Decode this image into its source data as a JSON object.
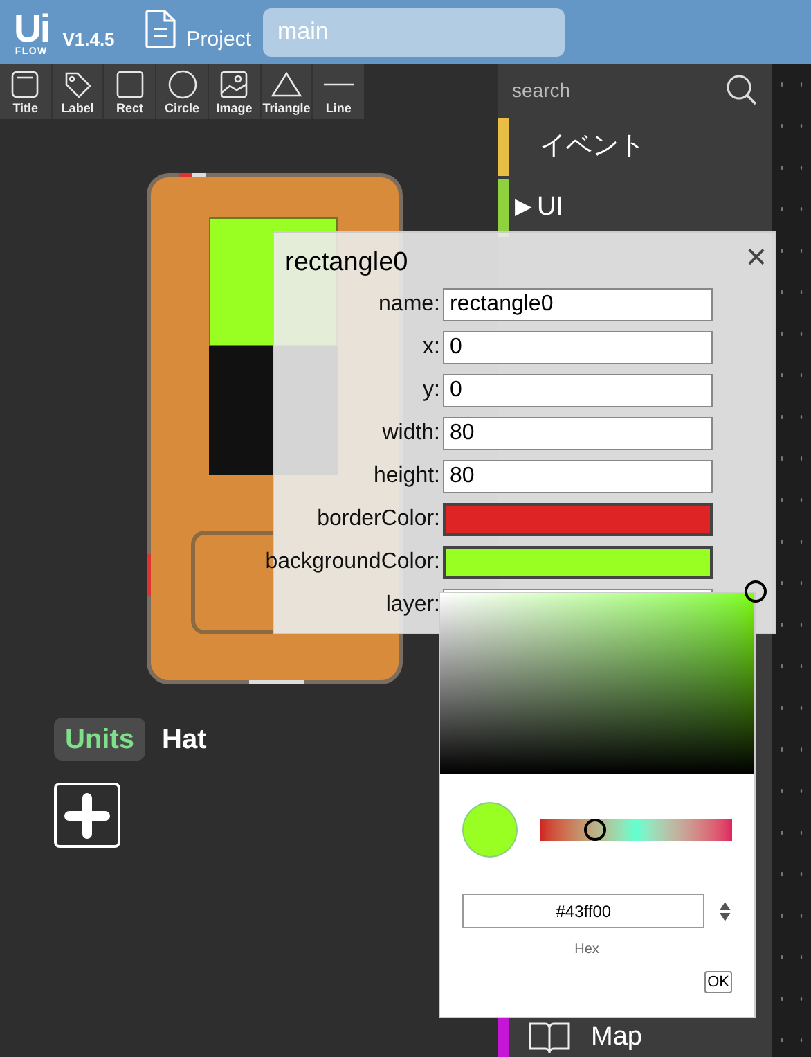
{
  "header": {
    "logo_top": "Ui",
    "logo_bottom": "FLOW",
    "version": "V1.4.5",
    "project_label": "Project",
    "file_name": "main"
  },
  "toolbar": [
    {
      "kind": "title",
      "label": "Title"
    },
    {
      "kind": "label",
      "label": "Label"
    },
    {
      "kind": "rect",
      "label": "Rect"
    },
    {
      "kind": "circle",
      "label": "Circle"
    },
    {
      "kind": "image",
      "label": "Image"
    },
    {
      "kind": "triangle",
      "label": "Triangle"
    },
    {
      "kind": "line",
      "label": "Line"
    }
  ],
  "unit_tabs": [
    {
      "label": "Units",
      "selected": true
    },
    {
      "label": "Hat",
      "selected": false
    }
  ],
  "sidebar": {
    "search_placeholder": "search",
    "categories": [
      {
        "label": "イベント",
        "color": "#e8be45"
      },
      {
        "label": "UI",
        "color": "#8fd13e",
        "arrow": "▶"
      }
    ],
    "bottom_item": {
      "label": "Map",
      "color": "#c516d6"
    }
  },
  "dialog": {
    "title": "rectangle0",
    "close": "×",
    "fields": [
      {
        "kind": "text",
        "label": "name:",
        "value": "rectangle0"
      },
      {
        "kind": "text",
        "label": "x:",
        "value": "0"
      },
      {
        "kind": "text",
        "label": "y:",
        "value": "0"
      },
      {
        "kind": "text",
        "label": "width:",
        "value": "80"
      },
      {
        "kind": "text",
        "label": "height:",
        "value": "80"
      },
      {
        "kind": "color",
        "label": "borderColor:",
        "color": "#de2424"
      },
      {
        "kind": "color",
        "label": "backgroundColor:",
        "color": "#99ff22"
      },
      {
        "kind": "select",
        "label": "layer:"
      }
    ]
  },
  "color_picker": {
    "hue": {
      "level": 0.29
    },
    "hex": "#43ff00",
    "hex_label": "Hex",
    "ok": "OK"
  }
}
